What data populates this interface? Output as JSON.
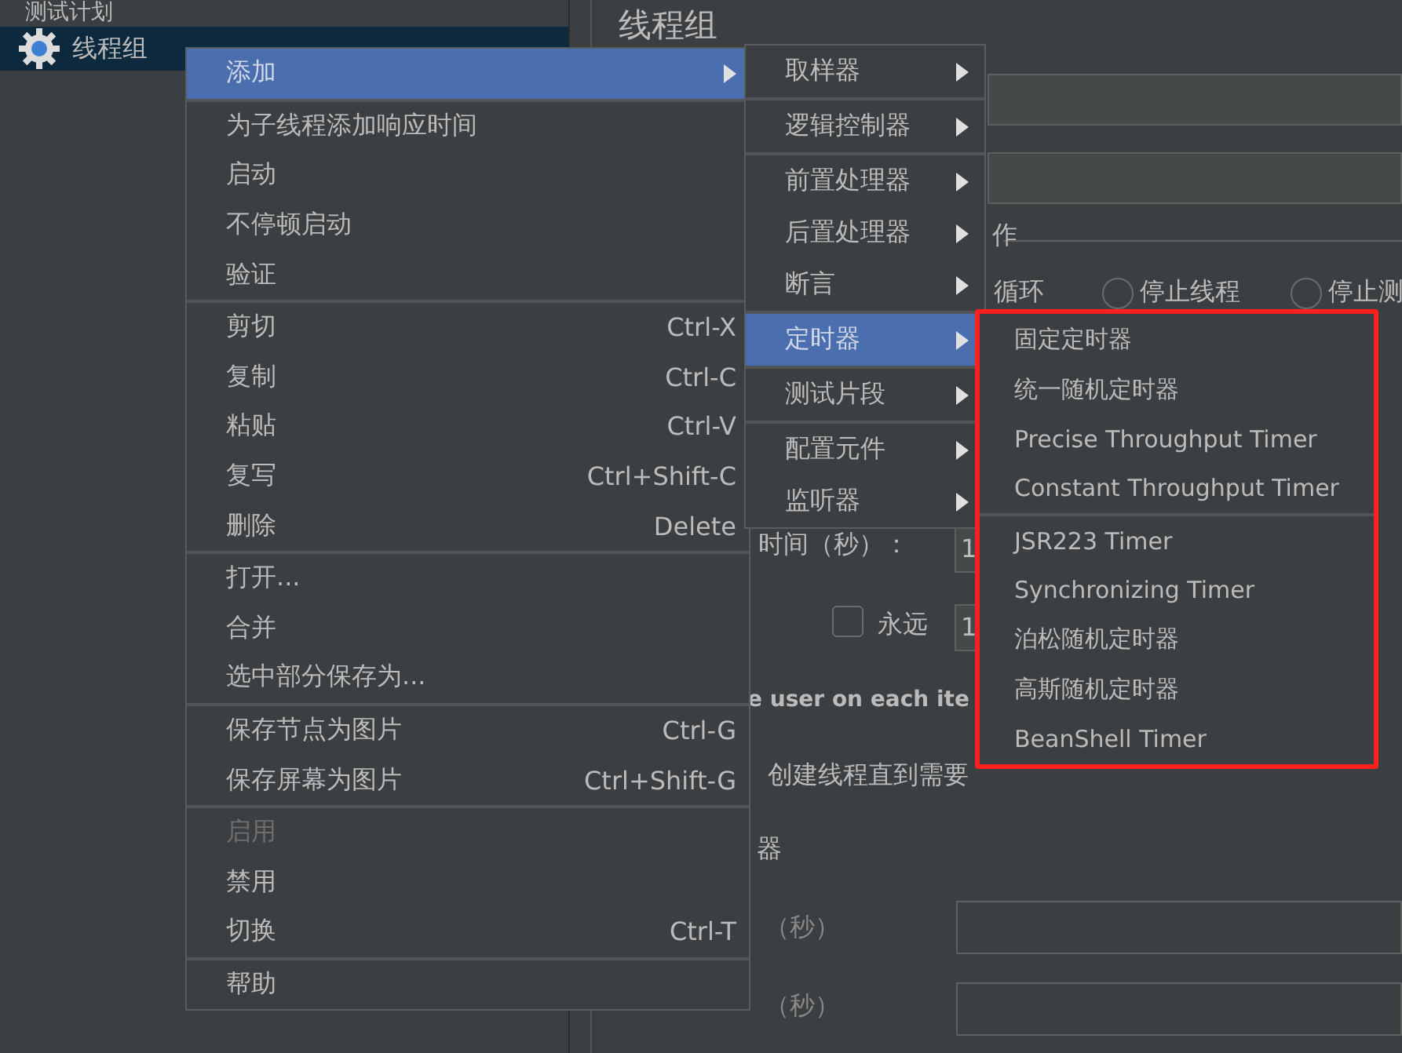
{
  "tree": [
    {
      "label": "测试计划",
      "selected": false
    },
    {
      "label": "线程组",
      "selected": true
    }
  ],
  "panel": {
    "title": "线程组",
    "section_label": "作",
    "loop_label": "循环",
    "radios": [
      {
        "label": "停止线程",
        "selected": false
      },
      {
        "label": "停止测",
        "selected": false
      }
    ],
    "rampup_label": "时间（秒）：",
    "rampup_value": "1",
    "forever": {
      "label": "永远",
      "checked": false
    },
    "loop_value": "1",
    "same_user_label": "e user on each ite",
    "delay_label": "创建线程直到需要",
    "scheduler_label": "器",
    "duration_label": "（秒）",
    "startup_delay_label": "（秒）"
  },
  "context_menu": {
    "groups": [
      [
        {
          "label": "添加",
          "submenu": true,
          "selected": true,
          "disabled": false
        }
      ],
      [
        {
          "label": "为子线程添加响应时间",
          "submenu": false,
          "selected": false,
          "disabled": false
        },
        {
          "label": "启动",
          "submenu": false,
          "selected": false,
          "disabled": false
        },
        {
          "label": "不停顿启动",
          "submenu": false,
          "selected": false,
          "disabled": false
        },
        {
          "label": "验证",
          "submenu": false,
          "selected": false,
          "disabled": false
        }
      ],
      [
        {
          "label": "剪切",
          "shortcut": "Ctrl-X",
          "submenu": false,
          "selected": false,
          "disabled": false
        },
        {
          "label": "复制",
          "shortcut": "Ctrl-C",
          "submenu": false,
          "selected": false,
          "disabled": false
        },
        {
          "label": "粘贴",
          "shortcut": "Ctrl-V",
          "submenu": false,
          "selected": false,
          "disabled": false
        },
        {
          "label": "复写",
          "shortcut": "Ctrl+Shift-C",
          "submenu": false,
          "selected": false,
          "disabled": false
        },
        {
          "label": "删除",
          "shortcut": "Delete",
          "submenu": false,
          "selected": false,
          "disabled": false
        }
      ],
      [
        {
          "label": "打开...",
          "submenu": false,
          "selected": false,
          "disabled": false
        },
        {
          "label": "合并",
          "submenu": false,
          "selected": false,
          "disabled": false
        },
        {
          "label": "选中部分保存为...",
          "submenu": false,
          "selected": false,
          "disabled": false
        }
      ],
      [
        {
          "label": "保存节点为图片",
          "shortcut": "Ctrl-G",
          "submenu": false,
          "selected": false,
          "disabled": false
        },
        {
          "label": "保存屏幕为图片",
          "shortcut": "Ctrl+Shift-G",
          "submenu": false,
          "selected": false,
          "disabled": false
        }
      ],
      [
        {
          "label": "启用",
          "submenu": false,
          "selected": false,
          "disabled": true
        },
        {
          "label": "禁用",
          "submenu": false,
          "selected": false,
          "disabled": false
        },
        {
          "label": "切换",
          "shortcut": "Ctrl-T",
          "submenu": false,
          "selected": false,
          "disabled": false
        }
      ],
      [
        {
          "label": "帮助",
          "submenu": false,
          "selected": false,
          "disabled": false
        }
      ]
    ]
  },
  "add_submenu": {
    "groups": [
      [
        {
          "label": "取样器",
          "submenu": true,
          "selected": false
        }
      ],
      [
        {
          "label": "逻辑控制器",
          "submenu": true,
          "selected": false
        }
      ],
      [
        {
          "label": "前置处理器",
          "submenu": true,
          "selected": false
        },
        {
          "label": "后置处理器",
          "submenu": true,
          "selected": false
        },
        {
          "label": "断言",
          "submenu": true,
          "selected": false
        }
      ],
      [
        {
          "label": "定时器",
          "submenu": true,
          "selected": true
        }
      ],
      [
        {
          "label": "测试片段",
          "submenu": true,
          "selected": false
        }
      ],
      [
        {
          "label": "配置元件",
          "submenu": true,
          "selected": false
        },
        {
          "label": "监听器",
          "submenu": true,
          "selected": false
        }
      ]
    ]
  },
  "timer_submenu": {
    "highlighted": true,
    "groups": [
      [
        {
          "label": "固定定时器",
          "selected": false
        },
        {
          "label": "统一随机定时器",
          "selected": false
        },
        {
          "label": "Precise Throughput Timer",
          "selected": false
        },
        {
          "label": "Constant Throughput Timer",
          "selected": false
        }
      ],
      [
        {
          "label": "JSR223 Timer",
          "selected": false
        },
        {
          "label": "Synchronizing Timer",
          "selected": false
        },
        {
          "label": "泊松随机定时器",
          "selected": false
        },
        {
          "label": "高斯随机定时器",
          "selected": false
        },
        {
          "label": "BeanShell Timer",
          "selected": false
        }
      ]
    ]
  }
}
